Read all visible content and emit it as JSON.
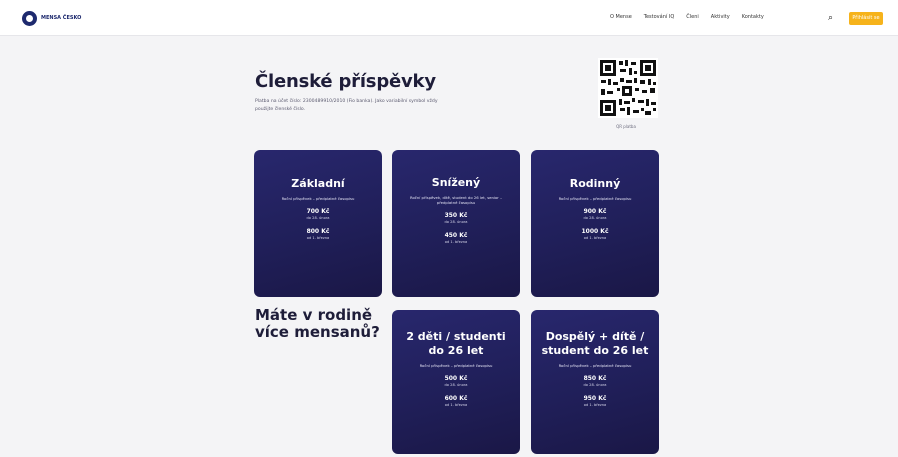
{
  "nav": {
    "logo_text": "MENSA ČESKO",
    "items": [
      "O Mense",
      "Testování IQ",
      "Členi",
      "Aktivity",
      "Kontakty"
    ],
    "cta": "Přihlásit se"
  },
  "page": {
    "title": "Členské příspěvky",
    "lead": "Platba na účet číslo: 2300489910/2010 (Fio banka). Jako variabilní symbol vždy použijte členské číslo.",
    "qr_label": "QR platba"
  },
  "cards": [
    {
      "title": "Základní",
      "sub": "Roční příspěvek – předplatné časopisu",
      "price1": "700 Kč",
      "note1": "do 28. února",
      "price2": "800 Kč",
      "note2": "od 1. března"
    },
    {
      "title": "Snížený",
      "sub": "Roční příspěvek, dítě, student do 26 let, senior – předplatné časopisu",
      "price1": "350 Kč",
      "note1": "do 28. února",
      "price2": "450 Kč",
      "note2": "od 1. března"
    },
    {
      "title": "Rodinný",
      "sub": "Roční příspěvek – předplatné časopisu",
      "price1": "900 Kč",
      "note1": "do 28. února",
      "price2": "1000 Kč",
      "note2": "od 1. března"
    }
  ],
  "family": {
    "heading_line1": "Máte v rodině",
    "heading_line2": "více mensanů?",
    "cards": [
      {
        "title": "2 děti / studenti do 26 let",
        "sub": "Roční příspěvek – předplatné časopisu",
        "price1": "500 Kč",
        "note1": "do 28. února",
        "price2": "600 Kč",
        "note2": "od 1. března"
      },
      {
        "title": "Dospělý + dítě / student do 26 let",
        "sub": "Roční příspěvek – předplatné časopisu",
        "price1": "850 Kč",
        "note1": "do 28. února",
        "price2": "950 Kč",
        "note2": "od 1. března"
      }
    ]
  },
  "colors": {
    "card": "#232163",
    "accent": "#f6b31b",
    "text_dark": "#1e1d39"
  }
}
